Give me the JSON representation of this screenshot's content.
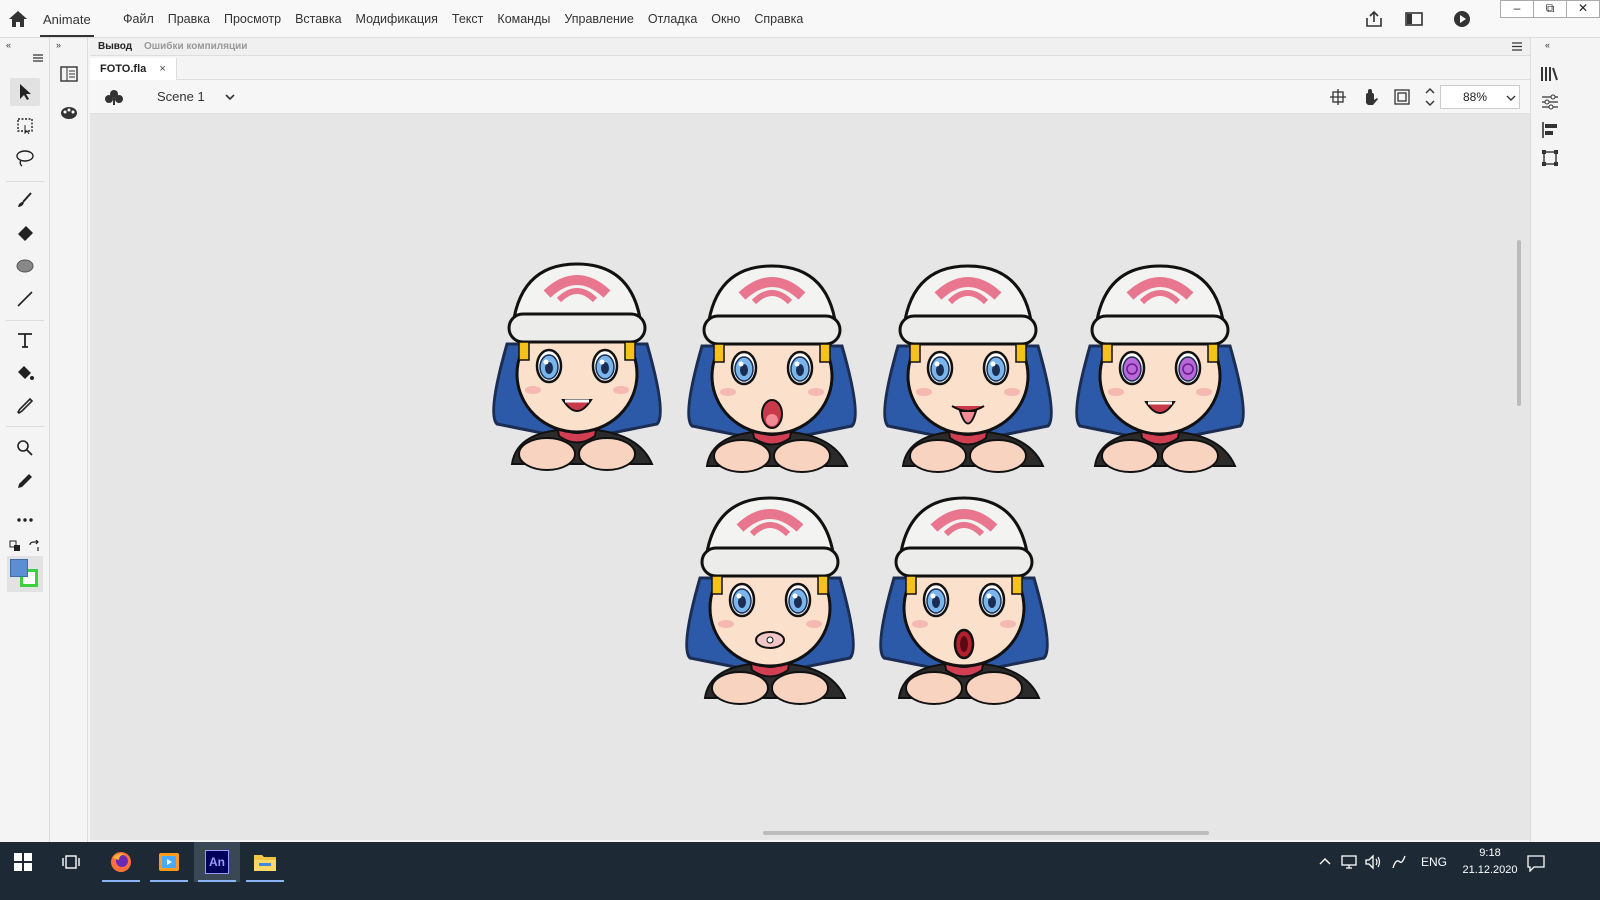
{
  "app": {
    "name": "Animate"
  },
  "menu": [
    "Файл",
    "Правка",
    "Просмотр",
    "Вставка",
    "Модификация",
    "Текст",
    "Команды",
    "Управление",
    "Отладка",
    "Окно",
    "Справка"
  ],
  "output_tabs": {
    "output": "Вывод",
    "errors": "Ошибки компиляции"
  },
  "document": {
    "tab_title": "FOTO.fla",
    "close_glyph": "×"
  },
  "scene": {
    "name": "Scene 1"
  },
  "zoom": {
    "value": "88%"
  },
  "window_buttons": {
    "minimize": "–",
    "restore": "⧉",
    "close": "✕"
  },
  "stage": {
    "background": "#e6e6e6",
    "characters": [
      {
        "expression": "happy"
      },
      {
        "expression": "surprised"
      },
      {
        "expression": "tongue-out"
      },
      {
        "expression": "hypnotized"
      },
      {
        "expression": "lips-pout"
      },
      {
        "expression": "shocked"
      }
    ]
  },
  "colors": {
    "stroke": "#5b8fd4",
    "fill": "#3cd13c",
    "accent_ui": "#2a6cc4"
  },
  "taskbar": {
    "apps": [
      {
        "name": "windows-start",
        "active": false
      },
      {
        "name": "task-view",
        "active": false
      },
      {
        "name": "firefox",
        "active": false
      },
      {
        "name": "media-player",
        "active": false
      },
      {
        "name": "animate",
        "label": "An",
        "active": true
      },
      {
        "name": "file-explorer",
        "active": false
      }
    ],
    "language": "ENG",
    "time": "9:18",
    "date": "21.12.2020"
  }
}
